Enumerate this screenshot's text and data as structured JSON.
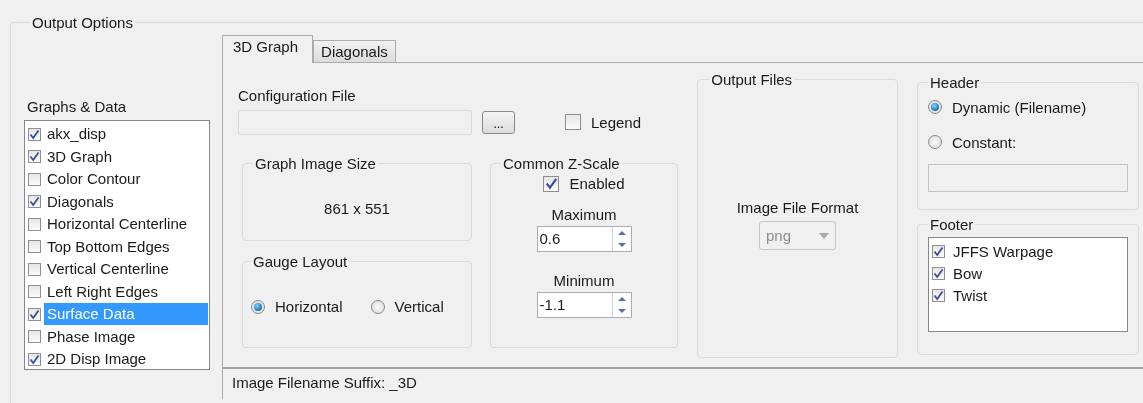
{
  "group_title": "Output Options",
  "graphs_label": "Graphs & Data",
  "graphs": [
    {
      "label": "akx_disp",
      "checked": true,
      "selected": false
    },
    {
      "label": "3D Graph",
      "checked": true,
      "selected": false
    },
    {
      "label": "Color Contour",
      "checked": false,
      "selected": false
    },
    {
      "label": "Diagonals",
      "checked": true,
      "selected": false
    },
    {
      "label": "Horizontal Centerline",
      "checked": false,
      "selected": false
    },
    {
      "label": "Top Bottom Edges",
      "checked": false,
      "selected": false
    },
    {
      "label": "Vertical Centerline",
      "checked": false,
      "selected": false
    },
    {
      "label": "Left Right Edges",
      "checked": false,
      "selected": false
    },
    {
      "label": "Surface Data",
      "checked": true,
      "selected": true
    },
    {
      "label": "Phase Image",
      "checked": false,
      "selected": false
    },
    {
      "label": "2D Disp Image",
      "checked": true,
      "selected": false
    }
  ],
  "tabs": [
    {
      "label": "3D Graph",
      "selected": true
    },
    {
      "label": "Diagonals",
      "selected": false
    }
  ],
  "config_file": {
    "label": "Configuration File",
    "disabled": true,
    "browse": "..."
  },
  "legend": {
    "label": "Legend",
    "checked": false
  },
  "graph_image_size": {
    "title": "Graph Image Size",
    "value": "861 x 551"
  },
  "gauge_layout": {
    "title": "Gauge Layout",
    "options": [
      {
        "label": "Horizontal",
        "selected": true
      },
      {
        "label": "Vertical",
        "selected": false
      }
    ]
  },
  "z_scale": {
    "title": "Common Z-Scale",
    "enabled": {
      "label": "Enabled",
      "checked": true
    },
    "maximum": {
      "label": "Maximum",
      "value": "0.6"
    },
    "minimum": {
      "label": "Minimum",
      "value": "-1.1"
    }
  },
  "output_files": {
    "title": "Output Files",
    "format_label": "Image File Format",
    "format": {
      "value": "png",
      "disabled": true
    }
  },
  "header": {
    "title": "Header",
    "options": [
      {
        "label": "Dynamic (Filename)",
        "selected": true
      },
      {
        "label": "Constant:",
        "selected": false
      }
    ],
    "constant_field": {
      "disabled": true
    }
  },
  "footer": {
    "title": "Footer",
    "items": [
      {
        "label": "JFFS Warpage",
        "checked": true
      },
      {
        "label": "Bow",
        "checked": true
      },
      {
        "label": "Twist",
        "checked": true
      }
    ]
  },
  "status": "Image Filename Suffix: _3D"
}
